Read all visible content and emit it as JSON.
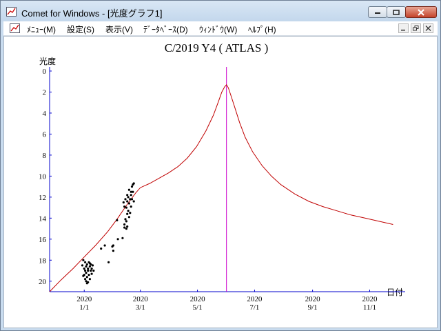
{
  "window": {
    "title": "Comet for Windows - [光度グラフ1]",
    "icon": "chart-app-icon",
    "caption_buttons": [
      "minimize-icon",
      "maximize-icon",
      "close-icon"
    ]
  },
  "menu": {
    "items": [
      {
        "label": "ﾒﾆｭｰ(M)"
      },
      {
        "label": "設定(S)"
      },
      {
        "label": "表示(V)"
      },
      {
        "label": "ﾃﾞｰﾀﾍﾞｰｽ(D)"
      },
      {
        "label": "ｳｨﾝﾄﾞｳ(W)"
      },
      {
        "label": "ﾍﾙﾌﾟ(H)"
      }
    ],
    "mdi_buttons": [
      "mdi-minimize-icon",
      "mdi-restore-icon",
      "mdi-close-icon"
    ]
  },
  "chart_data": {
    "type": "line",
    "title": "C/2019 Y4 ( ATLAS )",
    "xlabel": "日付",
    "ylabel": "光度",
    "ylim": [
      0,
      21
    ],
    "y_inverted": true,
    "y_ticks": [
      0,
      2,
      4,
      6,
      8,
      10,
      12,
      14,
      16,
      18,
      20
    ],
    "x_ticks": [
      {
        "year": "2020",
        "md": "1/1"
      },
      {
        "year": "2020",
        "md": "3/1"
      },
      {
        "year": "2020",
        "md": "5/1"
      },
      {
        "year": "2020",
        "md": "7/1"
      },
      {
        "year": "2020",
        "md": "9/1"
      },
      {
        "year": "2020",
        "md": "11/1"
      }
    ],
    "x_ticks_day": [
      0,
      60,
      121,
      182,
      244,
      305
    ],
    "xlim_day": [
      -37,
      340
    ],
    "perihelion_day": 152,
    "colors": {
      "curve": "#c00000",
      "axis": "#0000cc",
      "vline": "#cc00cc",
      "points": "#000000"
    },
    "series": [
      {
        "kind": "predicted",
        "x_day": [
          -37,
          -25,
          -12,
          0,
          12,
          25,
          35,
          45,
          55,
          60,
          70,
          80,
          90,
          100,
          110,
          120,
          130,
          138,
          143,
          147,
          150,
          152,
          154,
          157,
          161,
          166,
          172,
          180,
          190,
          200,
          210,
          225,
          240,
          255,
          270,
          285,
          300,
          315,
          330
        ],
        "y_mag": [
          21,
          19.9,
          18.8,
          17.7,
          16.6,
          15.3,
          14.1,
          12.8,
          11.6,
          11.1,
          10.7,
          10.2,
          9.7,
          9.1,
          8.3,
          7.2,
          5.7,
          4.2,
          3.0,
          2.0,
          1.5,
          1.3,
          1.6,
          2.4,
          3.5,
          4.9,
          6.3,
          7.7,
          9.0,
          10.0,
          10.8,
          11.7,
          12.4,
          12.9,
          13.3,
          13.7,
          14.0,
          14.3,
          14.6
        ]
      },
      {
        "kind": "observed",
        "points": [
          [
            -2,
            18.5
          ],
          [
            -1,
            18.0
          ],
          [
            0,
            18.8
          ],
          [
            0,
            19.4
          ],
          [
            1,
            18.2
          ],
          [
            1,
            19.0
          ],
          [
            1,
            19.8
          ],
          [
            2,
            18.6
          ],
          [
            2,
            19.2
          ],
          [
            3,
            18.4
          ],
          [
            3,
            19.6
          ],
          [
            3,
            20.2
          ],
          [
            4,
            18.8
          ],
          [
            4,
            19.0
          ],
          [
            5,
            18.2
          ],
          [
            5,
            19.4
          ],
          [
            6,
            18.6
          ],
          [
            6,
            19.8
          ],
          [
            7,
            18.4
          ],
          [
            7,
            19.0
          ],
          [
            8,
            18.8
          ],
          [
            8,
            19.3
          ],
          [
            9,
            18.5
          ],
          [
            2,
            20.0
          ],
          [
            4,
            20.1
          ],
          [
            -1,
            19.5
          ],
          [
            10,
            19.0
          ],
          [
            6,
            18.3
          ],
          [
            18,
            16.9
          ],
          [
            22,
            16.6
          ],
          [
            26,
            18.2
          ],
          [
            30,
            16.7
          ],
          [
            31,
            16.6
          ],
          [
            31,
            17.1
          ],
          [
            35,
            14.2
          ],
          [
            36,
            16.0
          ],
          [
            41,
            15.9
          ],
          [
            42,
            12.5
          ],
          [
            43,
            12.9
          ],
          [
            43,
            14.6
          ],
          [
            43,
            14.9
          ],
          [
            44,
            12.2
          ],
          [
            44,
            14.1
          ],
          [
            45,
            13.0
          ],
          [
            45,
            14.3
          ],
          [
            45,
            15.0
          ],
          [
            46,
            11.8
          ],
          [
            46,
            12.4
          ],
          [
            46,
            13.6
          ],
          [
            46,
            14.8
          ],
          [
            47,
            12.0
          ],
          [
            47,
            13.3
          ],
          [
            48,
            11.3
          ],
          [
            48,
            12.6
          ],
          [
            48,
            13.9
          ],
          [
            49,
            12.2
          ],
          [
            49,
            13.5
          ],
          [
            50,
            11.5
          ],
          [
            50,
            11.8
          ],
          [
            50,
            12.9
          ],
          [
            51,
            11.0
          ],
          [
            51,
            12.2
          ],
          [
            52,
            10.8
          ],
          [
            52,
            11.5
          ],
          [
            53,
            12.4
          ],
          [
            53,
            10.7
          ]
        ]
      }
    ]
  }
}
